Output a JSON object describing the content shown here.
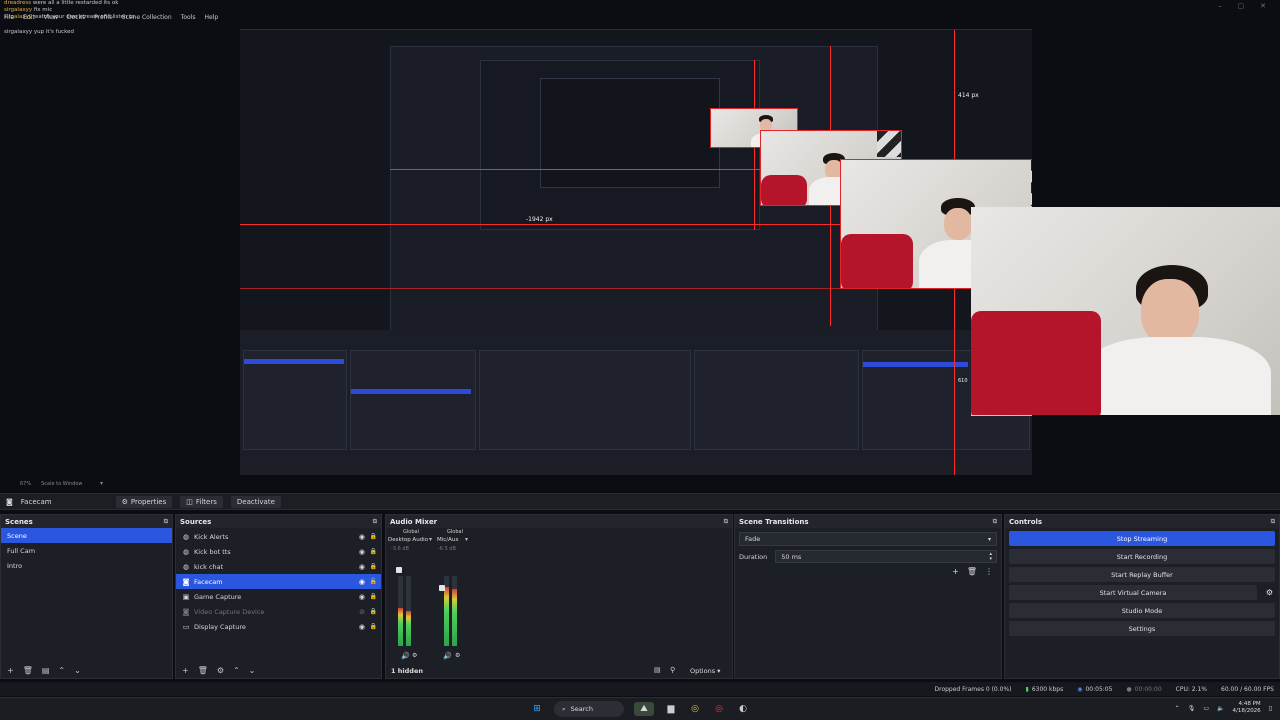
{
  "chat": [
    {
      "user": "dreadress",
      "text": "were all a little restarded its ok"
    },
    {
      "user": "sirgalaxyy",
      "text": "fix mic"
    },
    {
      "user": "sirgalaxyy",
      "text": "watch your own stream and listen to"
    },
    {
      "user": "sirgalaxyy",
      "text": "yup it's fucked"
    }
  ],
  "menubar": [
    "File",
    "Edit",
    "View",
    "Docks",
    "Profile",
    "Scene Collection",
    "Tools",
    "Help"
  ],
  "preview": {
    "measure_top": "414 px",
    "measure_left": "-1942 px",
    "measure_right": "610",
    "status_left": "67%",
    "status_mode": "Scale to Window"
  },
  "context_bar": {
    "source_name": "Facecam",
    "properties_label": "Properties",
    "filters_label": "Filters",
    "deactivate_label": "Deactivate"
  },
  "scenes": {
    "title": "Scenes",
    "items": [
      "Scene",
      "Full Cam",
      "Intro"
    ],
    "selected": 0
  },
  "sources": {
    "title": "Sources",
    "items": [
      {
        "name": "Kick Alerts",
        "icon": "globe-icon",
        "dim": false
      },
      {
        "name": "Kick bot tts",
        "icon": "globe-icon",
        "dim": false
      },
      {
        "name": "kick chat",
        "icon": "globe-icon",
        "dim": false
      },
      {
        "name": "Facecam",
        "icon": "camera-icon",
        "dim": false
      },
      {
        "name": "Game Capture",
        "icon": "gamepad-icon",
        "dim": false
      },
      {
        "name": "Video Capture Device",
        "icon": "camera-icon",
        "dim": true
      },
      {
        "name": "Display Capture",
        "icon": "monitor-icon",
        "dim": false
      }
    ],
    "selected": 3
  },
  "audio_mixer": {
    "title": "Audio Mixer",
    "channels": [
      {
        "tag": "Global",
        "name": "Desktop Audio",
        "db": "-3.6 dB",
        "level": 0.55
      },
      {
        "tag": "Global",
        "name": "Mic/Aux",
        "db": "-6.5 dB",
        "level": 0.85
      }
    ],
    "hidden_label": "1 hidden",
    "options_label": "Options"
  },
  "scene_transitions": {
    "title": "Scene Transitions",
    "transition": "Fade",
    "duration_label": "Duration",
    "duration_value": "50 ms"
  },
  "controls": {
    "title": "Controls",
    "buttons": [
      "Stop Streaming",
      "Start Recording",
      "Start Replay Buffer",
      "Start Virtual Camera",
      "Studio Mode",
      "Settings"
    ],
    "active": 0
  },
  "statusbar": {
    "dropped": "Dropped Frames 0 (0.0%)",
    "bitrate": "6300 kbps",
    "live_time": "00:05:05",
    "rec_time": "00:00:00",
    "cpu": "CPU: 2.1%",
    "fps": "60.00 / 60.00 FPS"
  },
  "taskbar": {
    "search_label": "Search",
    "time": "4:48 PM",
    "date": "4/18/2026"
  },
  "colors": {
    "accent": "#2a56e0",
    "guide_red": "#ff2b2b",
    "live_green": "#4fcf5c"
  }
}
